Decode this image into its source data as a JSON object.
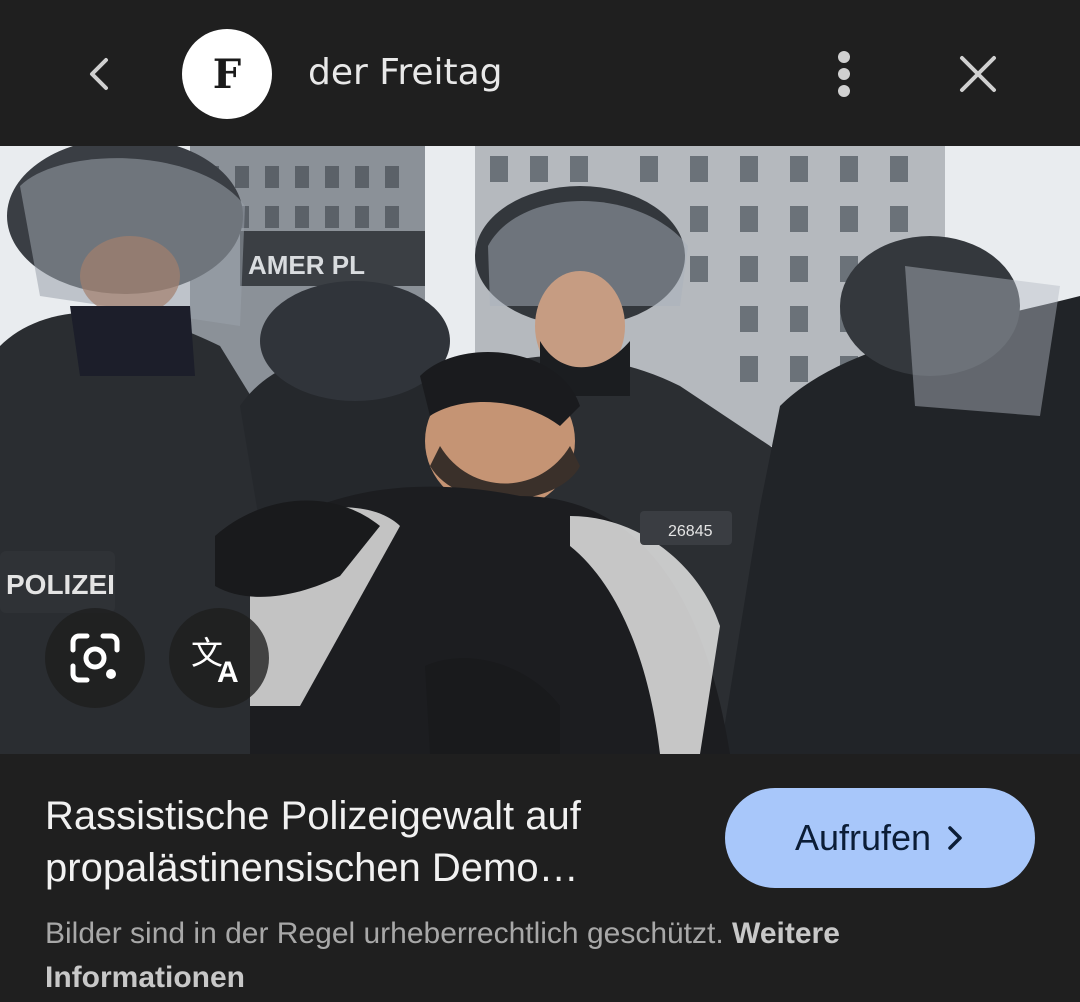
{
  "header": {
    "logo_letter": "F",
    "site_name": "der Freitag"
  },
  "icons": {
    "back": "chevron-left-icon",
    "more": "more-vertical-icon",
    "close": "close-icon",
    "lens": "google-lens-icon",
    "translate": "translate-icon",
    "open_chevron": "chevron-right-icon"
  },
  "image": {
    "badge_text": "POLIZEI",
    "name_tag": "26845",
    "building_sign": "AMER PL"
  },
  "result": {
    "title": "Rassistische Polizeigewalt auf propalästinensischen Demo…",
    "open_label": "Aufrufen",
    "copyright_text": "Bilder sind in der Regel urheberrechtlich geschützt.",
    "more_info_label": "Weitere Informationen"
  },
  "colors": {
    "background": "#1f1f1f",
    "button_bg": "#a8c7fa",
    "button_text": "#0b1d36"
  }
}
